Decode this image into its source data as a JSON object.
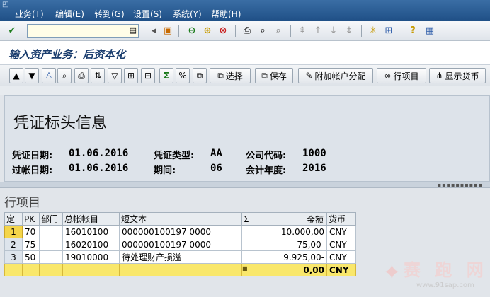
{
  "menu": [
    "业务(T)",
    "编辑(E)",
    "转到(G)",
    "设置(S)",
    "系统(Y)",
    "帮助(H)"
  ],
  "toolbar": {
    "command_value": ""
  },
  "title": "输入资产业务：后资本化",
  "buttons": {
    "select": "选择",
    "save": "保存",
    "account_assignment": "附加帐户分配",
    "line_items": "行项目",
    "display_currency": "显示货币"
  },
  "header": {
    "section_title": "凭证标头信息",
    "fields": [
      {
        "label": "凭证日期:",
        "value": "01.06.2016"
      },
      {
        "label": "凭证类型:",
        "value": "AA"
      },
      {
        "label": "公司代码:",
        "value": "1000"
      },
      {
        "label": "过帐日期:",
        "value": "01.06.2016"
      },
      {
        "label": "期间:",
        "value": "06"
      },
      {
        "label": "会计年度:",
        "value": "2016"
      }
    ]
  },
  "items": {
    "section_title": "行项目",
    "columns": [
      "定",
      "PK",
      "部门",
      "总帐帐目",
      "短文本",
      "Σ",
      "金额",
      "货币"
    ],
    "rows": [
      {
        "no": "1",
        "pk": "70",
        "dept": "",
        "gl": "16010100",
        "text": "000000100197 0000",
        "amount": "10.000,00",
        "currency": "CNY"
      },
      {
        "no": "2",
        "pk": "75",
        "dept": "",
        "gl": "16020100",
        "text": "000000100197 0000",
        "amount": "75,00-",
        "currency": "CNY"
      },
      {
        "no": "3",
        "pk": "50",
        "dept": "",
        "gl": "19010000",
        "text": "待处理财产损溢",
        "amount": "9.925,00-",
        "currency": "CNY"
      }
    ],
    "total": {
      "marker": "■",
      "amount": "0,00",
      "currency": "CNY"
    }
  },
  "watermark": {
    "big": "赛 跑 网",
    "small": "www.91sap.com"
  }
}
